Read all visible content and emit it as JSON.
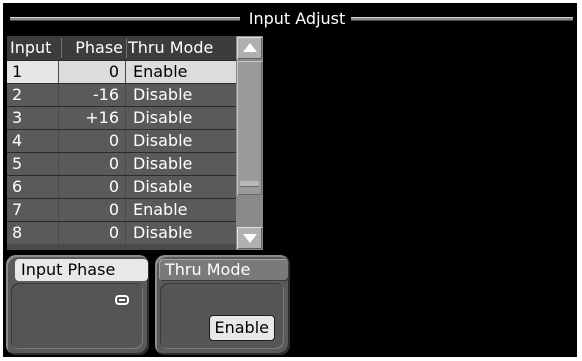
{
  "title": "Input Adjust",
  "table": {
    "headers": {
      "input": "Input",
      "phase": "Phase",
      "thru_mode": "Thru Mode"
    },
    "rows": [
      {
        "input": "1",
        "phase": "0",
        "thru_mode": "Enable",
        "selected": true
      },
      {
        "input": "2",
        "phase": "-16",
        "thru_mode": "Disable"
      },
      {
        "input": "3",
        "phase": "+16",
        "thru_mode": "Disable"
      },
      {
        "input": "4",
        "phase": "0",
        "thru_mode": "Disable"
      },
      {
        "input": "5",
        "phase": "0",
        "thru_mode": "Disable"
      },
      {
        "input": "6",
        "phase": "0",
        "thru_mode": "Disable"
      },
      {
        "input": "7",
        "phase": "0",
        "thru_mode": "Enable"
      },
      {
        "input": "8",
        "phase": "0",
        "thru_mode": "Disable"
      }
    ]
  },
  "scrollbar": {
    "up_icon": "triangle-up-icon",
    "down_icon": "triangle-down-icon"
  },
  "panels": {
    "input_phase": {
      "label": "Input Phase",
      "icon": "knob-icon"
    },
    "thru_mode": {
      "label": "Thru Mode",
      "value": "Enable"
    }
  }
}
